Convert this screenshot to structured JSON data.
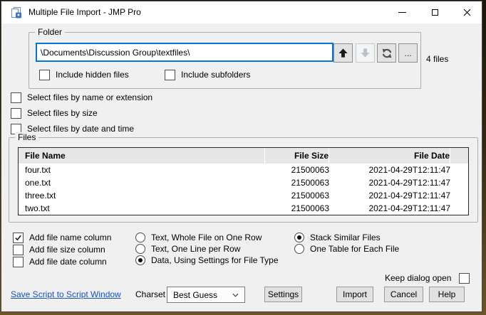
{
  "window": {
    "title": "Multiple File Import - JMP Pro"
  },
  "folder": {
    "legend": "Folder",
    "path_value": "\\Documents\\Discussion Group\\textfiles\\",
    "browse_label": "...",
    "include_hidden": {
      "label": "Include hidden files",
      "checked": false
    },
    "include_subfolders": {
      "label": "Include subfolders",
      "checked": false
    },
    "file_count": "4 files"
  },
  "filters": {
    "by_name": {
      "label": "Select files by name or extension",
      "checked": false
    },
    "by_size": {
      "label": "Select files by size",
      "checked": false
    },
    "by_date": {
      "label": "Select files by date and time",
      "checked": false
    }
  },
  "files": {
    "legend": "Files",
    "columns": {
      "name": "File Name",
      "size": "File Size",
      "date": "File Date"
    },
    "rows": [
      {
        "name": "four.txt",
        "size": "21500063",
        "date": "2021-04-29T12:11:47"
      },
      {
        "name": "one.txt",
        "size": "21500063",
        "date": "2021-04-29T12:11:47"
      },
      {
        "name": "three.txt",
        "size": "21500063",
        "date": "2021-04-29T12:11:47"
      },
      {
        "name": "two.txt",
        "size": "21500063",
        "date": "2021-04-29T12:11:47"
      }
    ]
  },
  "options": {
    "add_name": {
      "label": "Add file name column",
      "checked": true
    },
    "add_size": {
      "label": "Add file size column",
      "checked": false
    },
    "add_date": {
      "label": "Add file date column",
      "checked": false
    },
    "import_mode": {
      "text_whole": "Text, Whole File on One Row",
      "text_line": "Text, One Line per Row",
      "data_settings": "Data, Using Settings for File Type",
      "selected": "Data, Using Settings for File Type"
    },
    "output_mode": {
      "stack": "Stack Similar Files",
      "one_table": "One Table for Each File",
      "selected": "Stack Similar Files"
    }
  },
  "footer": {
    "save_script_link": "Save Script to Script Window",
    "charset_label": "Charset",
    "charset_value": "Best Guess",
    "settings_button": "Settings",
    "keep_dialog_open": {
      "label": "Keep dialog open",
      "checked": false
    },
    "import_button": "Import",
    "cancel_button": "Cancel",
    "help_button": "Help"
  },
  "colors": {
    "focus_border": "#0078d7",
    "link": "#1353c4",
    "titlebar_bg": "#ffffff",
    "dialog_bg": "#f0f0f0",
    "table_header_bg": "#e7e7e7"
  }
}
